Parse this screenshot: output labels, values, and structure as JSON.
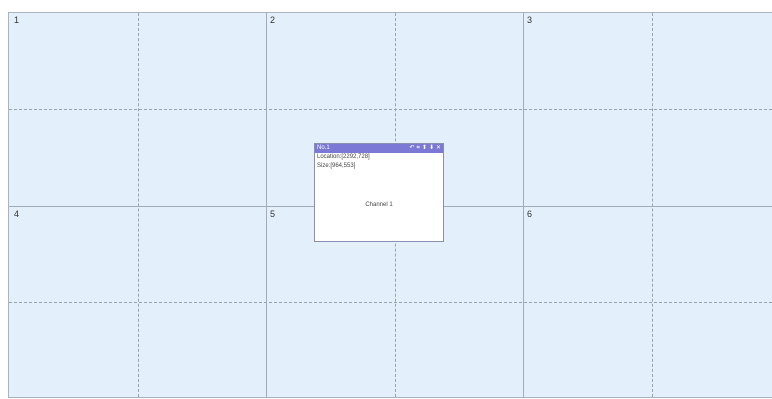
{
  "wall": {
    "screens": [
      {
        "number": "1"
      },
      {
        "number": "2"
      },
      {
        "number": "3"
      },
      {
        "number": "4"
      },
      {
        "number": "5"
      },
      {
        "number": "6"
      }
    ]
  },
  "window": {
    "title": "No.1",
    "location": "Location:[2292,728]",
    "size": "Size:[964,553]",
    "channel": "Channel 1",
    "controls": {
      "back": "↶",
      "maximize": "⌗",
      "up": "⬆",
      "down": "⬇",
      "close": "✕"
    }
  },
  "colors": {
    "wall_bg": "#e4effc",
    "title_bar": "#7b78d6"
  }
}
